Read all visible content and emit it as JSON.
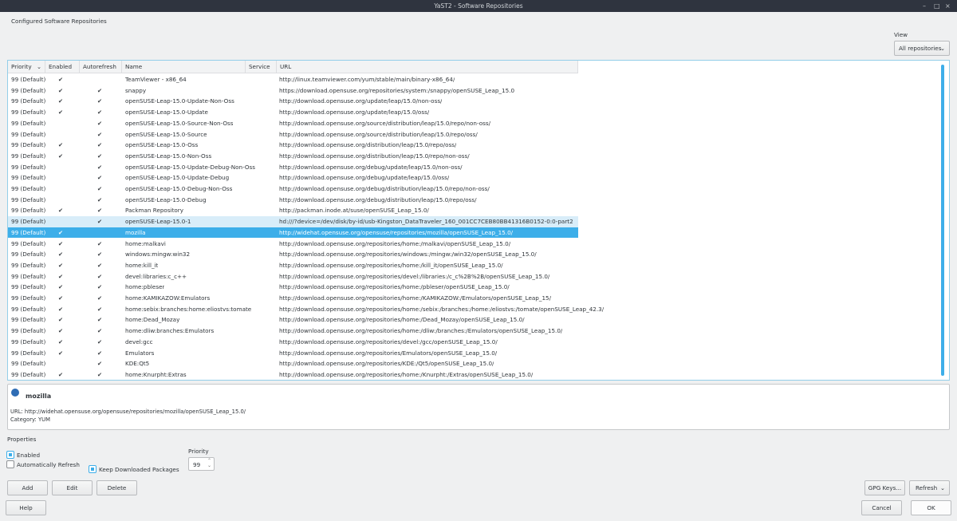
{
  "window": {
    "title": "YaST2 - Software Repositories",
    "minimize": "–",
    "maximize": "□",
    "close": "×"
  },
  "heading": "Configured Software Repositories",
  "view": {
    "label": "View",
    "selected": "All repositories"
  },
  "columns": [
    "Priority",
    "Enabled",
    "Autorefresh",
    "Name",
    "Service",
    "URL"
  ],
  "check_glyph": "✔",
  "rows": [
    {
      "priority": "99 (Default)",
      "enabled": true,
      "autorefresh": false,
      "name": "TeamViewer - x86_64",
      "service": "",
      "url": "http://linux.teamviewer.com/yum/stable/main/binary-x86_64/"
    },
    {
      "priority": "99 (Default)",
      "enabled": true,
      "autorefresh": true,
      "name": "snappy",
      "service": "",
      "url": "https://download.opensuse.org/repositories/system:/snappy/openSUSE_Leap_15.0"
    },
    {
      "priority": "99 (Default)",
      "enabled": true,
      "autorefresh": true,
      "name": "openSUSE-Leap-15.0-Update-Non-Oss",
      "service": "",
      "url": "http://download.opensuse.org/update/leap/15.0/non-oss/"
    },
    {
      "priority": "99 (Default)",
      "enabled": true,
      "autorefresh": true,
      "name": "openSUSE-Leap-15.0-Update",
      "service": "",
      "url": "http://download.opensuse.org/update/leap/15.0/oss/"
    },
    {
      "priority": "99 (Default)",
      "enabled": false,
      "autorefresh": true,
      "name": "openSUSE-Leap-15.0-Source-Non-Oss",
      "service": "",
      "url": "http://download.opensuse.org/source/distribution/leap/15.0/repo/non-oss/"
    },
    {
      "priority": "99 (Default)",
      "enabled": false,
      "autorefresh": true,
      "name": "openSUSE-Leap-15.0-Source",
      "service": "",
      "url": "http://download.opensuse.org/source/distribution/leap/15.0/repo/oss/"
    },
    {
      "priority": "99 (Default)",
      "enabled": true,
      "autorefresh": true,
      "name": "openSUSE-Leap-15.0-Oss",
      "service": "",
      "url": "http://download.opensuse.org/distribution/leap/15.0/repo/oss/"
    },
    {
      "priority": "99 (Default)",
      "enabled": true,
      "autorefresh": true,
      "name": "openSUSE-Leap-15.0-Non-Oss",
      "service": "",
      "url": "http://download.opensuse.org/distribution/leap/15.0/repo/non-oss/"
    },
    {
      "priority": "99 (Default)",
      "enabled": false,
      "autorefresh": true,
      "name": "openSUSE-Leap-15.0-Update-Debug-Non-Oss",
      "service": "",
      "url": "http://download.opensuse.org/debug/update/leap/15.0/non-oss/"
    },
    {
      "priority": "99 (Default)",
      "enabled": false,
      "autorefresh": true,
      "name": "openSUSE-Leap-15.0-Update-Debug",
      "service": "",
      "url": "http://download.opensuse.org/debug/update/leap/15.0/oss/"
    },
    {
      "priority": "99 (Default)",
      "enabled": false,
      "autorefresh": true,
      "name": "openSUSE-Leap-15.0-Debug-Non-Oss",
      "service": "",
      "url": "http://download.opensuse.org/debug/distribution/leap/15.0/repo/non-oss/"
    },
    {
      "priority": "99 (Default)",
      "enabled": false,
      "autorefresh": true,
      "name": "openSUSE-Leap-15.0-Debug",
      "service": "",
      "url": "http://download.opensuse.org/debug/distribution/leap/15.0/repo/oss/"
    },
    {
      "priority": "99 (Default)",
      "enabled": true,
      "autorefresh": true,
      "name": "Packman Repository",
      "service": "",
      "url": "http://packman.inode.at/suse/openSUSE_Leap_15.0/"
    },
    {
      "priority": "99 (Default)",
      "enabled": false,
      "autorefresh": true,
      "name": "openSUSE-Leap-15.0-1",
      "service": "",
      "url": "hd:///?device=/dev/disk/by-id/usb-Kingston_DataTraveler_160_001CC7CEB80BB41316B0152-0:0-part2",
      "state": "hover"
    },
    {
      "priority": "99 (Default)",
      "enabled": true,
      "autorefresh": false,
      "name": "mozilla",
      "service": "",
      "url": "http://widehat.opensuse.org/opensuse/repositories/mozilla/openSUSE_Leap_15.0/",
      "state": "selected"
    },
    {
      "priority": "99 (Default)",
      "enabled": true,
      "autorefresh": true,
      "name": "home:malkavi",
      "service": "",
      "url": "http://download.opensuse.org/repositories/home:/malkavi/openSUSE_Leap_15.0/"
    },
    {
      "priority": "99 (Default)",
      "enabled": true,
      "autorefresh": true,
      "name": "windows:mingw:win32",
      "service": "",
      "url": "http://download.opensuse.org/repositories/windows:/mingw:/win32/openSUSE_Leap_15.0/"
    },
    {
      "priority": "99 (Default)",
      "enabled": true,
      "autorefresh": true,
      "name": "home:kill_it",
      "service": "",
      "url": "http://download.opensuse.org/repositories/home:/kill_it/openSUSE_Leap_15.0/"
    },
    {
      "priority": "99 (Default)",
      "enabled": true,
      "autorefresh": true,
      "name": "devel:libraries:c_c++",
      "service": "",
      "url": "http://download.opensuse.org/repositories/devel:/libraries:/c_c%2B%2B/openSUSE_Leap_15.0/"
    },
    {
      "priority": "99 (Default)",
      "enabled": true,
      "autorefresh": true,
      "name": "home:pbleser",
      "service": "",
      "url": "http://download.opensuse.org/repositories/home:/pbleser/openSUSE_Leap_15.0/"
    },
    {
      "priority": "99 (Default)",
      "enabled": true,
      "autorefresh": true,
      "name": "home:KAMIKAZOW:Emulators",
      "service": "",
      "url": "http://download.opensuse.org/repositories/home:/KAMIKAZOW:/Emulators/openSUSE_Leap_15/"
    },
    {
      "priority": "99 (Default)",
      "enabled": true,
      "autorefresh": true,
      "name": "home:sebix:branches:home:eliostvs:tomate",
      "service": "",
      "url": "http://download.opensuse.org/repositories/home:/sebix:/branches:/home:/eliostvs:/tomate/openSUSE_Leap_42.3/"
    },
    {
      "priority": "99 (Default)",
      "enabled": true,
      "autorefresh": true,
      "name": "home:Dead_Mozay",
      "service": "",
      "url": "http://download.opensuse.org/repositories/home:/Dead_Mozay/openSUSE_Leap_15.0/"
    },
    {
      "priority": "99 (Default)",
      "enabled": true,
      "autorefresh": true,
      "name": "home:dliw:branches:Emulators",
      "service": "",
      "url": "http://download.opensuse.org/repositories/home:/dliw:/branches:/Emulators/openSUSE_Leap_15.0/"
    },
    {
      "priority": "99 (Default)",
      "enabled": true,
      "autorefresh": true,
      "name": "devel:gcc",
      "service": "",
      "url": "http://download.opensuse.org/repositories/devel:/gcc/openSUSE_Leap_15.0/"
    },
    {
      "priority": "99 (Default)",
      "enabled": true,
      "autorefresh": true,
      "name": "Emulators",
      "service": "",
      "url": "http://download.opensuse.org/repositories/Emulators/openSUSE_Leap_15.0/"
    },
    {
      "priority": "99 (Default)",
      "enabled": false,
      "autorefresh": true,
      "name": "KDE:Qt5",
      "service": "",
      "url": "http://download.opensuse.org/repositories/KDE:/Qt5/openSUSE_Leap_15.0/"
    },
    {
      "priority": "99 (Default)",
      "enabled": true,
      "autorefresh": true,
      "name": "home:Knurpht:Extras",
      "service": "",
      "url": "http://download.opensuse.org/repositories/home:/Knurpht:/Extras/openSUSE_Leap_15.0/"
    }
  ],
  "details": {
    "name": "mozilla",
    "url_line": "URL: http://widehat.opensuse.org/opensuse/repositories/mozilla/openSUSE_Leap_15.0/",
    "category_line": "Category: YUM"
  },
  "properties": {
    "label": "Properties",
    "enabled": {
      "label": "Enabled",
      "checked": true
    },
    "autorefresh": {
      "label": "Automatically Refresh",
      "checked": false
    },
    "keep": {
      "label": "Keep Downloaded Packages",
      "checked": true
    },
    "priority_label": "Priority",
    "priority_value": "99"
  },
  "buttons": {
    "add": "Add",
    "edit": "Edit",
    "delete": "Delete",
    "help": "Help",
    "gpg": "GPG Keys...",
    "refresh": "Refresh",
    "cancel": "Cancel",
    "ok": "OK"
  },
  "colors": {
    "accent": "#3daee9",
    "titlebar": "#2f343f"
  }
}
